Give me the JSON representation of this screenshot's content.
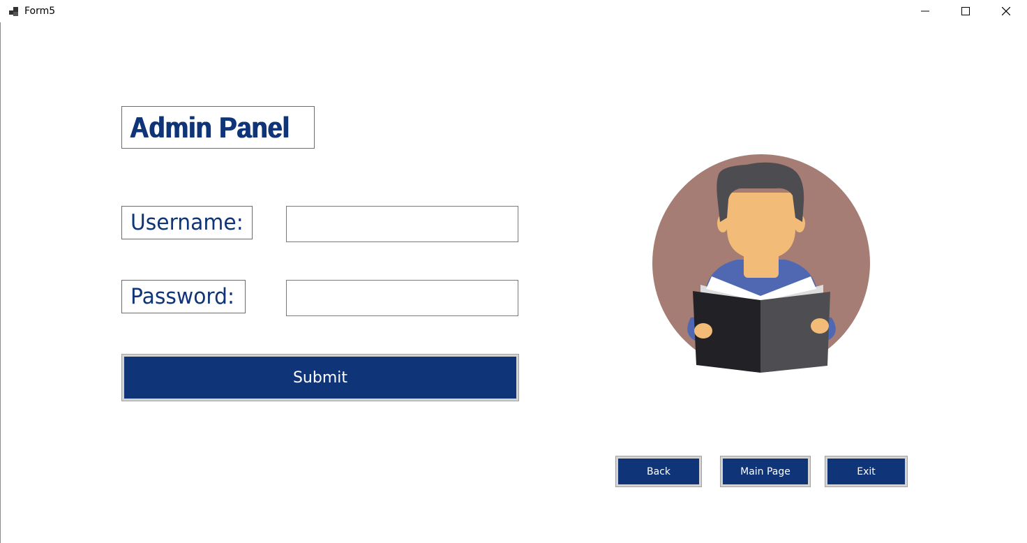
{
  "window": {
    "title": "Form5",
    "icon": "app-window-icon",
    "controls": {
      "minimize": "minimize-icon",
      "maximize": "maximize-icon",
      "close": "close-icon"
    }
  },
  "header": {
    "title": "Admin Panel"
  },
  "form": {
    "username_label": "Username:",
    "username_value": "",
    "password_label": "Password:",
    "password_value": "",
    "submit_label": "Submit"
  },
  "navigation": {
    "back_label": "Back",
    "main_page_label": "Main Page",
    "exit_label": "Exit"
  },
  "illustration": {
    "subject": "person-reading-book-icon"
  },
  "colors": {
    "accent": "#0f3578",
    "button_text": "#ffffff",
    "avatar_background": "#a57d74",
    "skin": "#f2bb78",
    "hair": "#4d4d51",
    "shirt": "#5068b2",
    "book_dark": "#222226",
    "book_light": "#4e4e52"
  }
}
